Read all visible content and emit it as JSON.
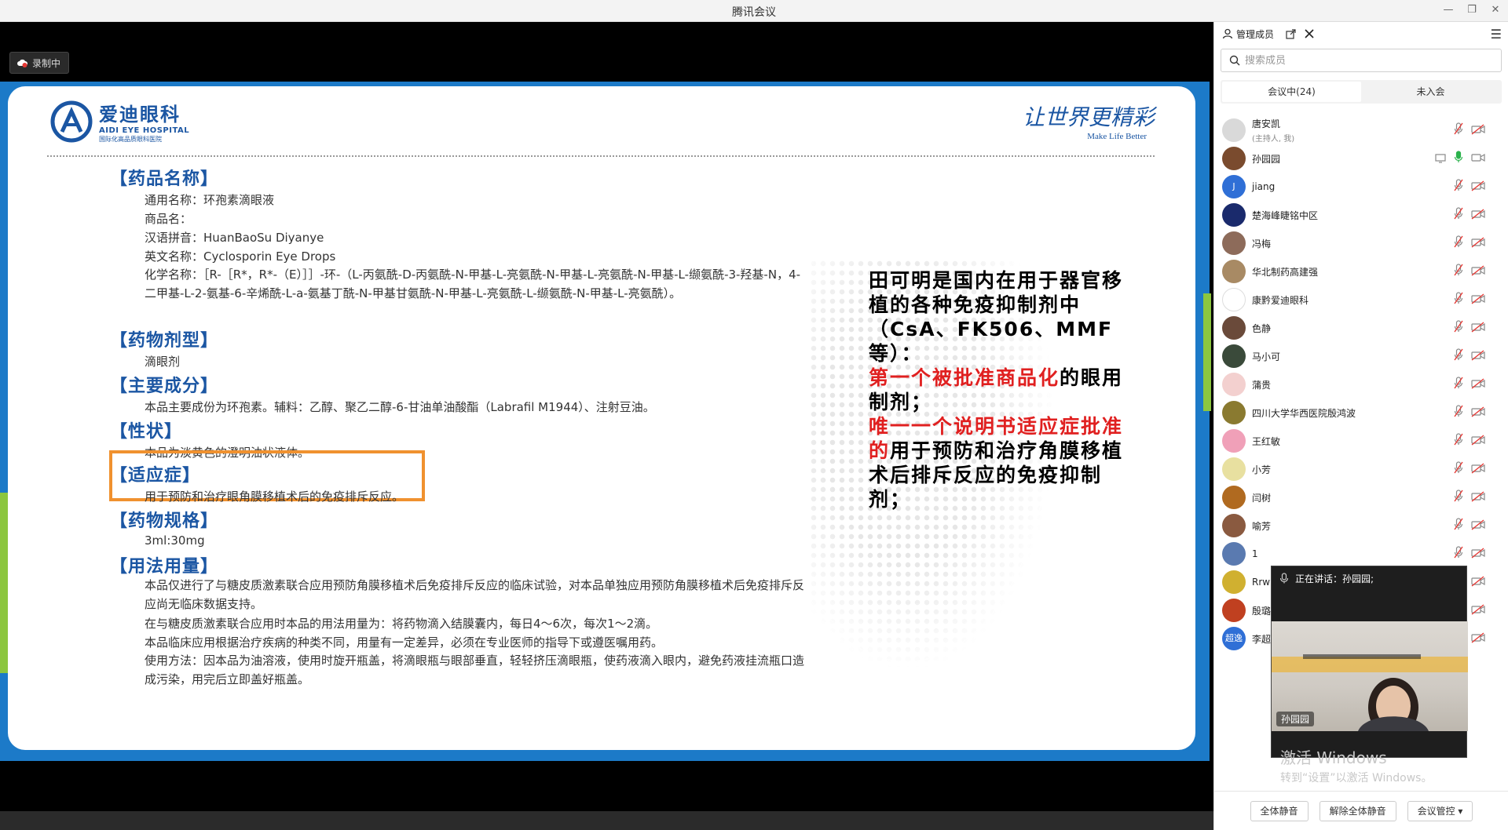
{
  "window": {
    "title": "腾讯会议",
    "minimize": "—",
    "restore": "❐",
    "close": "✕"
  },
  "recording": {
    "label": "录制中"
  },
  "slide": {
    "logo_cn": "爱迪眼科",
    "logo_en": "AIDI EYE HOSPITAL",
    "logo_sub": "国际化高品质眼科医院",
    "slogan_cn": "让世界更精彩",
    "slogan_en": "Make Life Better",
    "sections": {
      "name_title": "【药品名称】",
      "name_lines": [
        "通用名称：环孢素滴眼液",
        "商品名：",
        "汉语拼音：HuanBaoSu Diyanye",
        "英文名称：Cyclosporin Eye Drops",
        "化学名称：［R-［R*，R*-（E）］］-环-（L-丙氨酰-D-丙氨酰-N-甲基-L-亮氨酰-N-甲基-L-亮氨酰-N-甲基-L-缬氨酰-3-羟基-N，4-二甲基-L-2-氨基-6-辛烯酰-L-a-氨基丁酰-N-甲基甘氨酰-N-甲基-L-亮氨酰-L-缬氨酰-N-甲基-L-亮氨酰）。"
      ],
      "form_title": "【药物剂型】",
      "form_line": "滴眼剂",
      "ingredient_title": "【主要成分】",
      "ingredient_line": "本品主要成份为环孢素。辅料：乙醇、聚乙二醇-6-甘油单油酸酯（Labrafil M1944）、注射豆油。",
      "property_title": "【性状】",
      "property_line": "本品为淡黄色的澄明油状液体。",
      "indication_title": "【适应症】",
      "indication_line": "用于预防和治疗眼角膜移植术后的免疫排斥反应。",
      "spec_title": "【药物规格】",
      "spec_line": "3ml:30mg",
      "usage_title": "【用法用量】",
      "usage_lines": [
        "本品仅进行了与糖皮质激素联合应用预防角膜移植术后免疫排斥反应的临床试验，对本品单独应用预防角膜移植术后免疫排斥反应尚无临床数据支持。",
        "在与糖皮质激素联合应用时本品的用法用量为：将药物滴入结膜囊内，每日4～6次，每次1～2滴。",
        "本品临床应用根据治疗疾病的种类不同，用量有一定差异，必须在专业医师的指导下或遵医嘱用药。",
        "使用方法：因本品为油溶液，使用时旋开瓶盖，将滴眼瓶与眼部垂直，轻轻挤压滴眼瓶，使药液滴入眼内，避免药液挂流瓶口造成污染，用完后立即盖好瓶盖。"
      ]
    },
    "callout": {
      "part1": "田可明是国内在用于器官移植的各种免疫抑制剂中（CsA、FK506、MMF等）：",
      "red1": "第一个被批准商品化",
      "part2": "的眼用制剂；",
      "red2": "唯一一个说明书适应症批准的",
      "part3": "用于预防和治疗角膜移植术后排斥反应的免疫抑制剂；"
    }
  },
  "panel": {
    "title": "管理成员",
    "search_placeholder": "搜索成员",
    "tab_in_meeting": "会议中(24)",
    "tab_not_joined": "未入会",
    "members": [
      {
        "name": "唐安凯",
        "role": "(主持人, 我)",
        "avatar_color": "#d9d9d9",
        "avatar_text": ""
      },
      {
        "name": "孙园园",
        "role": "",
        "avatar_color": "#7a4b2e",
        "avatar_text": ""
      },
      {
        "name": "jiang",
        "role": "",
        "avatar_color": "#2f6fd6",
        "avatar_text": "J"
      },
      {
        "name": "楚海峰睫铭中区",
        "role": "",
        "avatar_color": "#1a2a6c",
        "avatar_text": ""
      },
      {
        "name": "冯梅",
        "role": "",
        "avatar_color": "#8d6b5a",
        "avatar_text": ""
      },
      {
        "name": "华北制药高建强",
        "role": "",
        "avatar_color": "#a88a64",
        "avatar_text": ""
      },
      {
        "name": "康黔爱迪眼科",
        "role": "",
        "avatar_color": "#ffffff",
        "avatar_text": ""
      },
      {
        "name": "色静",
        "role": "",
        "avatar_color": "#6a4a3a",
        "avatar_text": ""
      },
      {
        "name": "马小可",
        "role": "",
        "avatar_color": "#3a4a3a",
        "avatar_text": ""
      },
      {
        "name": "蒲贵",
        "role": "",
        "avatar_color": "#f3d0cf",
        "avatar_text": ""
      },
      {
        "name": "四川大学华西医院殷鸿波",
        "role": "",
        "avatar_color": "#8a7a30",
        "avatar_text": ""
      },
      {
        "name": "王红敏",
        "role": "",
        "avatar_color": "#f0a0b8",
        "avatar_text": ""
      },
      {
        "name": "小芳",
        "role": "",
        "avatar_color": "#e8e0a0",
        "avatar_text": ""
      },
      {
        "name": "闫树",
        "role": "",
        "avatar_color": "#b06a20",
        "avatar_text": ""
      },
      {
        "name": "喻芳",
        "role": "",
        "avatar_color": "#8a5a40",
        "avatar_text": ""
      },
      {
        "name": "1",
        "role": "",
        "avatar_color": "#5a7ab0",
        "avatar_text": ""
      },
      {
        "name": "Rrw",
        "role": "",
        "avatar_color": "#d0b030",
        "avatar_text": ""
      },
      {
        "name": "殷璐",
        "role": "",
        "avatar_color": "#c04020",
        "avatar_text": ""
      },
      {
        "name": "李超",
        "role": "",
        "avatar_color": "#2f6fd6",
        "avatar_text": "超逸"
      }
    ],
    "speaker_label": "正在讲话：孙园园;",
    "speaker_name": "孙园园",
    "btn_mute_all": "全体静音",
    "btn_unmute_all": "解除全体静音",
    "btn_meeting_control": "会议管控"
  },
  "activation": {
    "line1": "激活 Windows",
    "line2": "转到“设置”以激活 Windows。"
  },
  "colors": {
    "accent": "#1b56a3",
    "highlight": "#f0912f",
    "red": "#e02020",
    "green": "#8cc63f"
  }
}
